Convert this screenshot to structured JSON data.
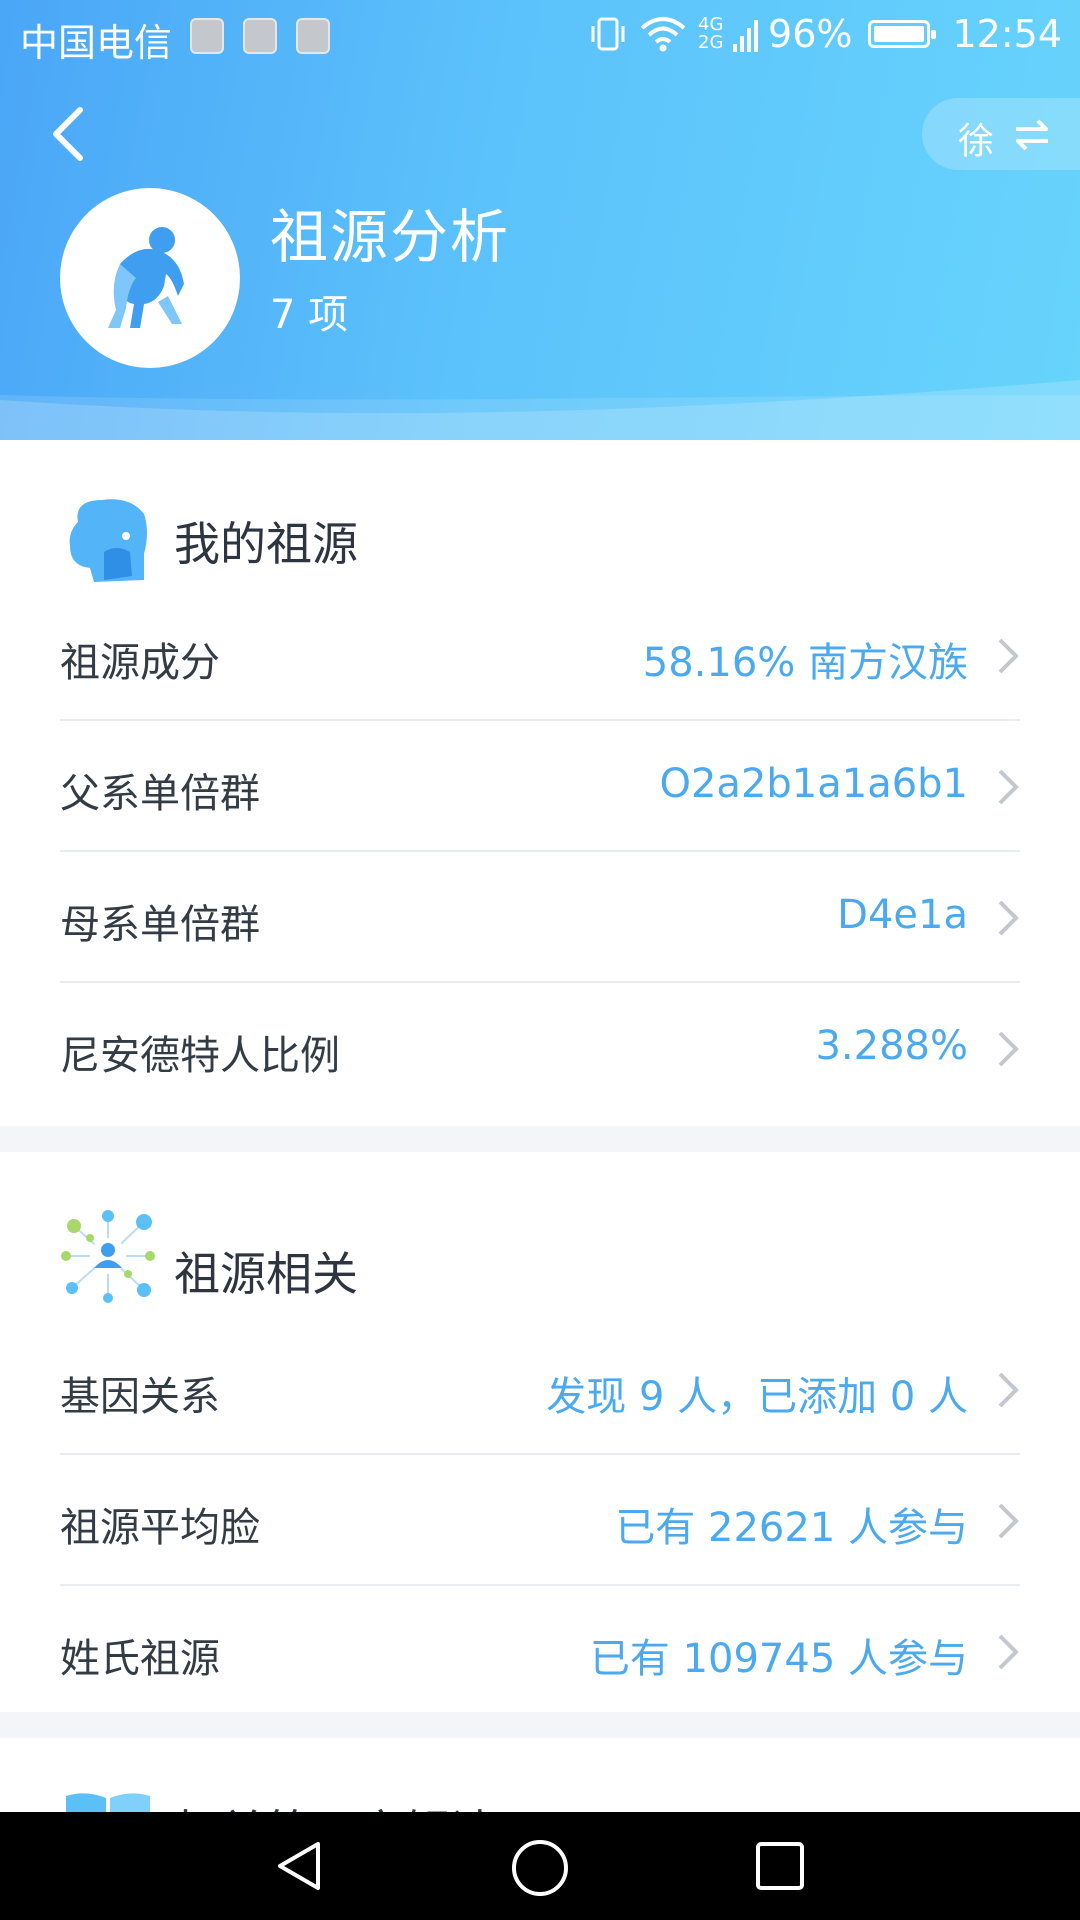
{
  "status_bar": {
    "carrier": "中国电信",
    "network": "4G 2G",
    "battery": "96%",
    "time": "12:54",
    "icons": [
      "health-icon",
      "gallery-icon",
      "photo-icon",
      "vibrate-icon",
      "wifi-icon",
      "signal-icon",
      "battery-icon"
    ]
  },
  "header": {
    "title": "祖源分析",
    "count": "7 项",
    "user_initial": "徐",
    "back_icon": "back-arrow-icon",
    "switch_icon": "swap-arrows-icon",
    "avatar_icon": "ape-icon"
  },
  "my_ancestry": {
    "title": "我的祖源",
    "icon": "face-profile-icon",
    "rows": [
      {
        "label": "祖源成分",
        "value": "58.16% 南方汉族"
      },
      {
        "label": "父系单倍群",
        "value": "O2a2b1a1a6b1"
      },
      {
        "label": "母系单倍群",
        "value": "D4e1a"
      },
      {
        "label": "尼安德特人比例",
        "value": "3.288%"
      }
    ]
  },
  "ancestry_related": {
    "title": "祖源相关",
    "icon": "network-people-icon",
    "rows": [
      {
        "label": "基因关系",
        "value": "发现 9 人，已添加 0 人"
      },
      {
        "label": "祖源平均脸",
        "value": "已有 22621 人参与"
      },
      {
        "label": "姓氏祖源",
        "value": "已有 109745 人参与"
      }
    ]
  },
  "third_section": {
    "title": "相关第三方解读",
    "icon": "book-icon"
  },
  "colors": {
    "header_start": "#4aa6f7",
    "header_end": "#67d4fc",
    "value_text": "#4aa9ef",
    "divider": "#e8ebef",
    "section_gap": "#f3f5f8"
  },
  "nav_bar": {
    "icons": [
      "back-triangle-icon",
      "home-circle-icon",
      "recents-square-icon"
    ]
  }
}
